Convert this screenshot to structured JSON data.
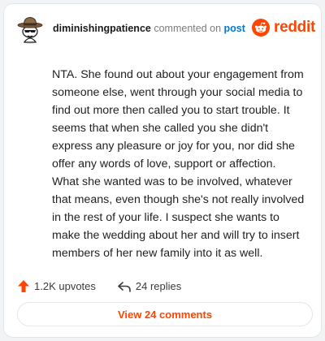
{
  "header": {
    "username": "diminishingpatience",
    "action_text": "commented on",
    "post_link": "post",
    "brand": "reddit"
  },
  "comment": {
    "body": "NTA. She found out about your engagement from someone else, went through your social media to find out more then called you to start trouble. It seems that when she called you she didn't express any pleasure or joy for you, nor did she offer any words of love, support or affection. What she wanted was to be involved, whatever that means, even though she's not really involved in the rest of your life. I suspect she wants to make the wedding about her and will try to insert members of her new family into it as well."
  },
  "stats": {
    "upvotes": "1.2K upvotes",
    "replies": "24 replies"
  },
  "footer": {
    "view_comments_label": "View 24 comments"
  },
  "icons": {
    "avatar": "snoo-cowboy-avatar",
    "brand": "reddit-snoo-icon",
    "upvote": "upvote-arrow-icon",
    "reply": "reply-arrow-icon"
  },
  "colors": {
    "brand": "#ff4500",
    "link": "#0079d3",
    "upvote": "#ff4500",
    "muted": "#7c7c7c"
  }
}
